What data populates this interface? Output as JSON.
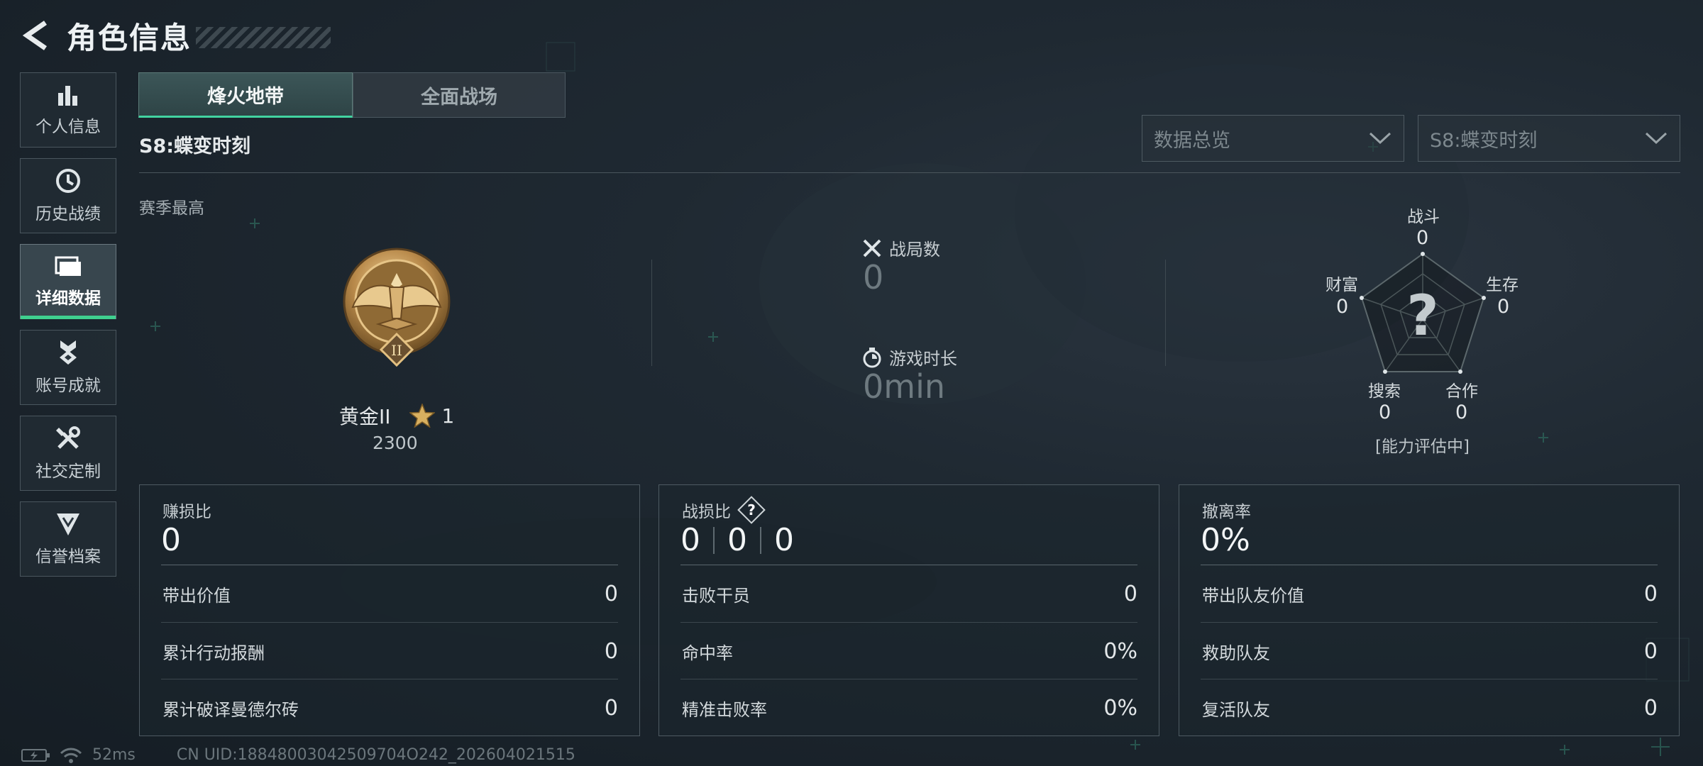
{
  "header": {
    "title": "角色信息",
    "back_icon": "chevron-left-icon"
  },
  "sidebar": {
    "items": [
      {
        "label": "个人信息",
        "icon": "bar-chart-icon",
        "active": false
      },
      {
        "label": "历史战绩",
        "icon": "clock-history-icon",
        "active": false
      },
      {
        "label": "详细数据",
        "icon": "folder-icon",
        "active": true
      },
      {
        "label": "账号成就",
        "icon": "medal-icon",
        "active": false
      },
      {
        "label": "社交定制",
        "icon": "tools-icon",
        "active": false
      },
      {
        "label": "信誉档案",
        "icon": "shield-badge-icon",
        "active": false
      }
    ]
  },
  "tabs": [
    {
      "label": "烽火地带",
      "active": true
    },
    {
      "label": "全面战场",
      "active": false
    }
  ],
  "season": {
    "title": "S8:蝶变时刻",
    "best_label": "赛季最高"
  },
  "filters": {
    "data_type": {
      "value": "数据总览"
    },
    "season": {
      "value": "S8:蝶变时刻"
    }
  },
  "rank": {
    "name": "黄金II",
    "stars": "1",
    "score": "2300",
    "medal_numeral": "II"
  },
  "stats": {
    "matches_label": "战局数",
    "matches_value": "0",
    "playtime_label": "游戏时长",
    "playtime_value": "0min"
  },
  "radar": {
    "labels": {
      "combat": "战斗",
      "survival": "生存",
      "cooperation": "合作",
      "search": "搜索",
      "wealth": "财富"
    },
    "values": {
      "combat": "0",
      "survival": "0",
      "cooperation": "0",
      "search": "0",
      "wealth": "0"
    },
    "center_mark": "?",
    "status": "[能力评估中]"
  },
  "cards": [
    {
      "title": "赚损比",
      "big_value": "0",
      "rows": [
        {
          "label": "带出价值",
          "value": "0"
        },
        {
          "label": "累计行动报酬",
          "value": "0"
        },
        {
          "label": "累计破译曼德尔砖",
          "value": "0"
        }
      ]
    },
    {
      "title": "战损比",
      "help_mark": "?",
      "kd_values": [
        "0",
        "0",
        "0"
      ],
      "rows": [
        {
          "label": "击败干员",
          "value": "0"
        },
        {
          "label": "命中率",
          "value": "0%"
        },
        {
          "label": "精准击败率",
          "value": "0%"
        }
      ]
    },
    {
      "title": "撤离率",
      "big_value": "0%",
      "rows": [
        {
          "label": "带出队友价值",
          "value": "0"
        },
        {
          "label": "救助队友",
          "value": "0"
        },
        {
          "label": "复活队友",
          "value": "0"
        }
      ]
    }
  ],
  "footer": {
    "ping": "52ms",
    "uid": "CN UID:18848003042509704O242_202604021515"
  },
  "colors": {
    "accent": "#3fd08f",
    "background": "#1d2730",
    "panel_border": "#4e5a62",
    "gold": "#c9a25a"
  }
}
